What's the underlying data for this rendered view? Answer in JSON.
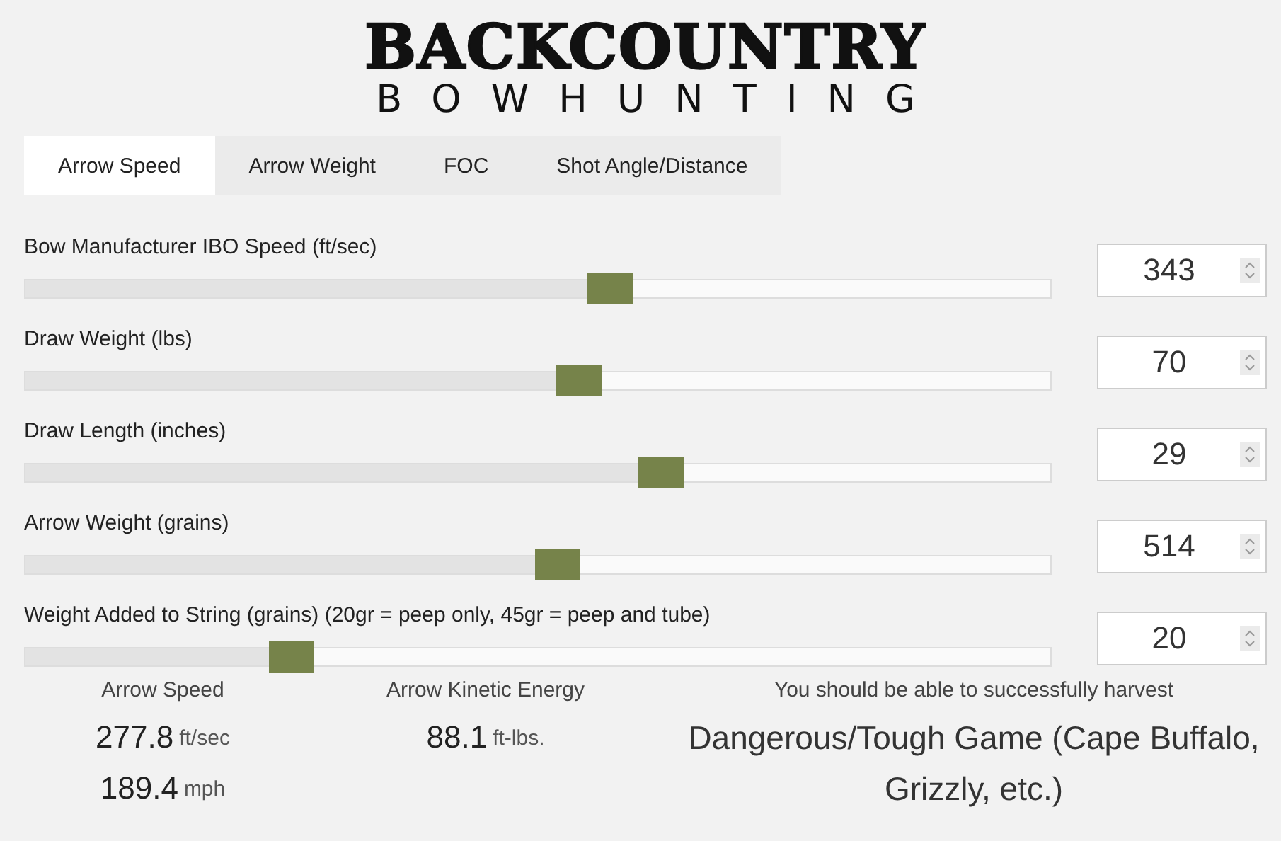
{
  "logo": {
    "title": "BACKCOUNTRY",
    "subtitle": "BOWHUNTING"
  },
  "tabs": [
    {
      "label": "Arrow Speed",
      "selected": true
    },
    {
      "label": "Arrow Weight",
      "selected": false
    },
    {
      "label": "FOC",
      "selected": false
    },
    {
      "label": "Shot Angle/Distance",
      "selected": false
    }
  ],
  "inputs": [
    {
      "label": "Bow Manufacturer IBO Speed (ft/sec)",
      "level": 0.57,
      "value": "343"
    },
    {
      "label": "Draw Weight (lbs)",
      "level": 0.54,
      "value": "70"
    },
    {
      "label": "Draw Length (inches)",
      "level": 0.62,
      "value": "29"
    },
    {
      "label": "Arrow Weight (grains)",
      "level": 0.52,
      "value": "514"
    },
    {
      "label": "Weight Added to String (grains) (20gr = peep only, 45gr = peep and tube)",
      "level": 0.26,
      "value": "20"
    }
  ],
  "results": [
    {
      "title": "Arrow Speed",
      "lines": [
        {
          "value": "277.8",
          "unit": "ft/sec"
        },
        {
          "value": "189.4",
          "unit": "mph"
        }
      ]
    },
    {
      "title": "Arrow Kinetic Energy",
      "lines": [
        {
          "value": "88.1",
          "unit": "ft-lbs."
        }
      ]
    }
  ],
  "verdict": {
    "title": "You should be able to successfully harvest",
    "text": "Dangerous/Tough Game (Cape Buffalo, Grizzly, etc.)"
  }
}
